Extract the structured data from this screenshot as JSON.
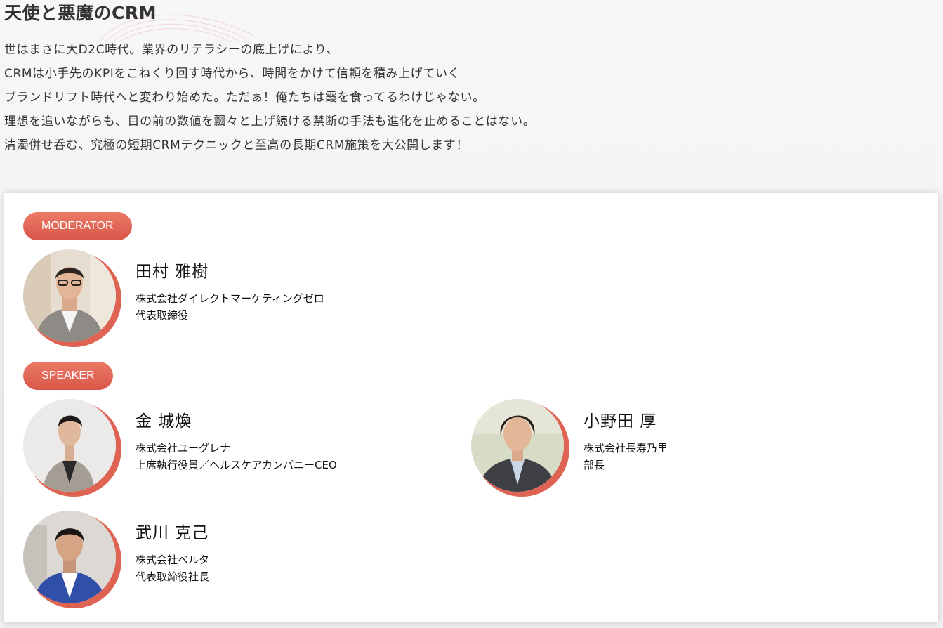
{
  "section": {
    "title": "天使と悪魔のCRM",
    "lead": [
      "世はまさに大D2C時代。業界のリテラシーの底上げにより、",
      "CRMは小手先のKPIをこねくり回す時代から、時間をかけて信頼を積み上げていく",
      "ブランドリフト時代へと変わり始めた。ただぁ！俺たちは霞を食ってるわけじゃない。",
      "理想を追いながらも、目の前の数値を飄々と上げ続ける禁断の手法も進化を止めることはない。",
      "清濁併せ呑む、究極の短期CRMテクニックと至高の長期CRM施策を大公開します！"
    ]
  },
  "moderator": {
    "label": "MODERATOR",
    "people": [
      {
        "name": "田村 雅樹",
        "org": "株式会社ダイレクトマーケティングゼロ",
        "title": "代表取締役"
      }
    ]
  },
  "speaker": {
    "label": "SPEAKER",
    "people": [
      {
        "name": "金 城煥",
        "org": "株式会社ユーグレナ",
        "title": "上席執行役員／ヘルスケアカンパニーCEO"
      },
      {
        "name": "小野田 厚",
        "org": "株式会社長寿乃里",
        "title": "部長"
      },
      {
        "name": "武川 克己",
        "org": "株式会社ベルタ",
        "title": "代表取締役社長"
      }
    ]
  },
  "colors": {
    "accent": "#df6352",
    "badge_top": "#eb7a66",
    "badge_bottom": "#d9574a"
  }
}
